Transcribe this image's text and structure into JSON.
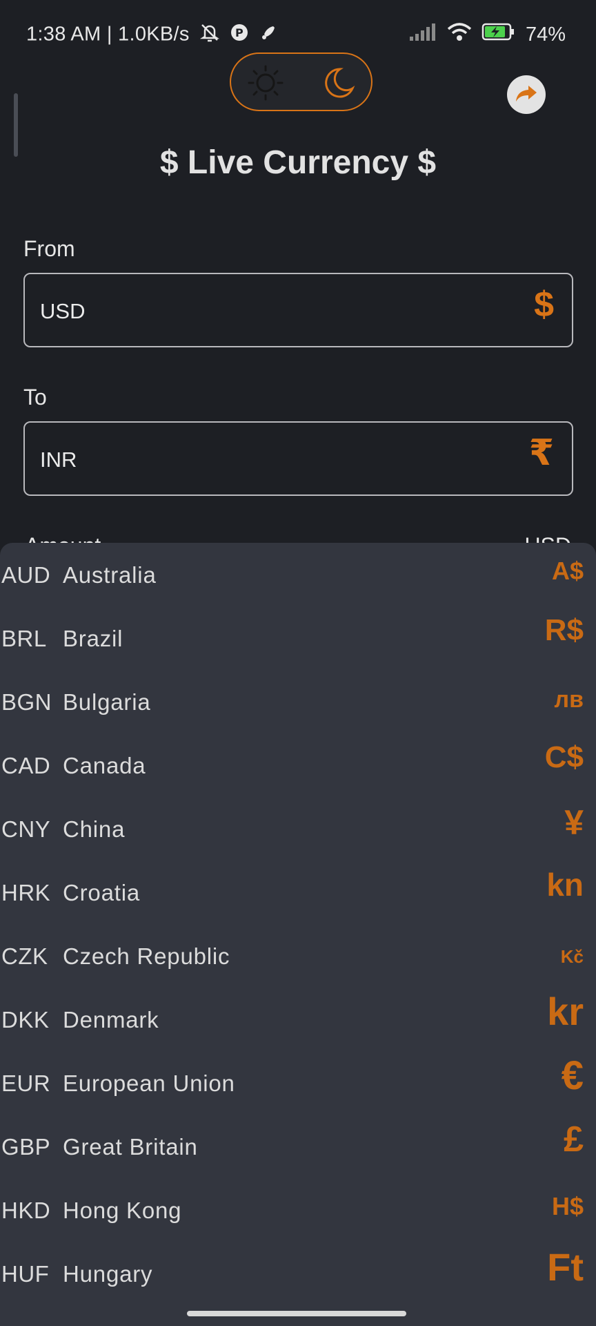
{
  "status_bar": {
    "left_text": "1:38 AM | 1.0KB/s",
    "battery": "74%",
    "icons": [
      "mute-bell-icon",
      "app-notification-icon",
      "rocket-icon",
      "signal-icon",
      "wifi-icon",
      "battery-charging-icon"
    ]
  },
  "theme_toggle": {
    "left_icon": "sun-icon",
    "right_icon": "moon-icon",
    "accent": "#d97417"
  },
  "share_icon": "share-icon",
  "title": "$ Live Currency $",
  "from": {
    "label": "From",
    "value": "USD",
    "symbol": "$"
  },
  "to": {
    "label": "To",
    "value": "INR",
    "symbol": "₹"
  },
  "amount": {
    "label": "Amount",
    "unit": "USD"
  },
  "currencies": [
    {
      "code": "AUD",
      "country": "Australia",
      "symbol": "A$"
    },
    {
      "code": "BRL",
      "country": "Brazil",
      "symbol": "R$"
    },
    {
      "code": "BGN",
      "country": "Bulgaria",
      "symbol": "лв"
    },
    {
      "code": "CAD",
      "country": "Canada",
      "symbol": "C$"
    },
    {
      "code": "CNY",
      "country": "China",
      "symbol": "¥"
    },
    {
      "code": "HRK",
      "country": "Croatia",
      "symbol": "kn"
    },
    {
      "code": "CZK",
      "country": "Czech Republic",
      "symbol": "Kč"
    },
    {
      "code": "DKK",
      "country": "Denmark",
      "symbol": "kr"
    },
    {
      "code": "EUR",
      "country": "European Union",
      "symbol": "€"
    },
    {
      "code": "GBP",
      "country": "Great Britain",
      "symbol": "£"
    },
    {
      "code": "HKD",
      "country": "Hong Kong",
      "symbol": "H$"
    },
    {
      "code": "HUF",
      "country": "Hungary",
      "symbol": "Ft"
    }
  ]
}
